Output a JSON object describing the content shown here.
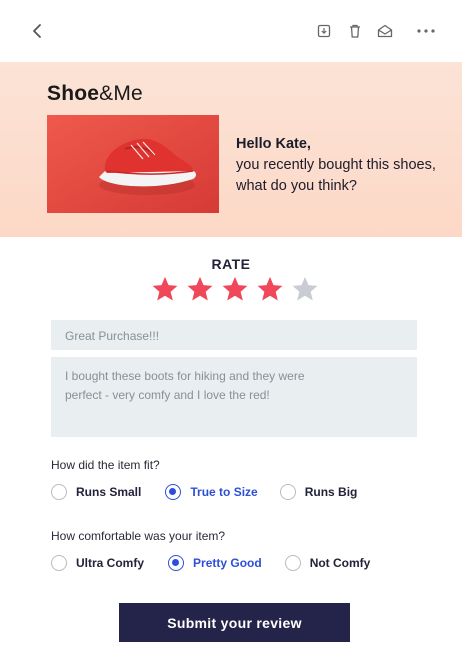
{
  "toolbar": {
    "icons": [
      "back-chevron-icon",
      "archive-icon",
      "trash-icon",
      "mark-unread-icon",
      "more-icon"
    ]
  },
  "email": {
    "brand_bold": "Shoe",
    "brand_light": "&Me",
    "greeting_name": "Hello Kate,",
    "greeting_text": "you recently bought this shoes, what do you think?",
    "hero_color": "#fdd8c6"
  },
  "rating": {
    "label": "RATE",
    "value": 4,
    "max": 5,
    "star_on_color": "#f0475a",
    "star_off_color": "#c9ccd3"
  },
  "review": {
    "title_value": "Great Purchase!!!",
    "body_value": "I bought these boots for hiking and they were perfect - very comfy and I love the red!"
  },
  "fit": {
    "question": "How did the item fit?",
    "options": [
      "Runs Small",
      "True to Size",
      "Runs Big"
    ],
    "selected": "True to Size"
  },
  "comfort": {
    "question": "How comfortable was your item?",
    "options": [
      "Ultra Comfy",
      "Pretty Good",
      "Not Comfy"
    ],
    "selected": "Pretty Good"
  },
  "submit_label": "Submit your review",
  "accent_color": "#2d4fd8",
  "button_color": "#24234a"
}
